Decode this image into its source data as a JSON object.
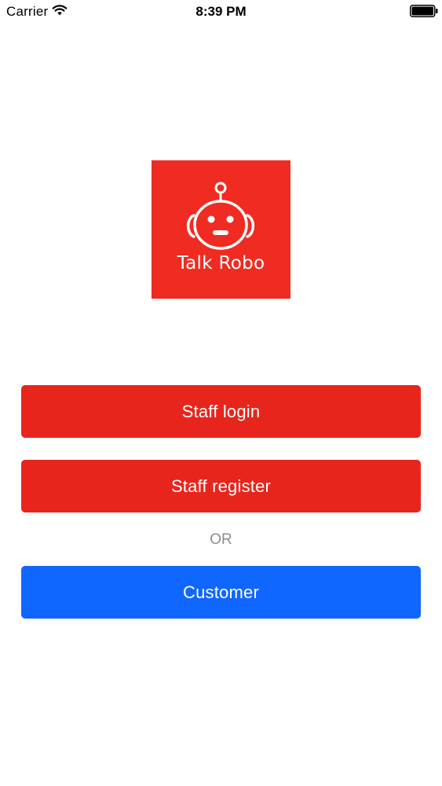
{
  "status_bar": {
    "carrier": "Carrier",
    "time": "8:39 PM",
    "wifi_icon": "wifi-icon",
    "battery_icon": "battery-icon"
  },
  "logo": {
    "title": "Talk Robo",
    "icon": "robot-icon",
    "background": "#ef2b22"
  },
  "buttons": {
    "staff_login": "Staff login",
    "staff_register": "Staff register",
    "customer": "Customer"
  },
  "separator": "OR",
  "colors": {
    "staff_button": "#e8251c",
    "customer_button": "#0f67ff",
    "separator_text": "#8e8e8e"
  }
}
